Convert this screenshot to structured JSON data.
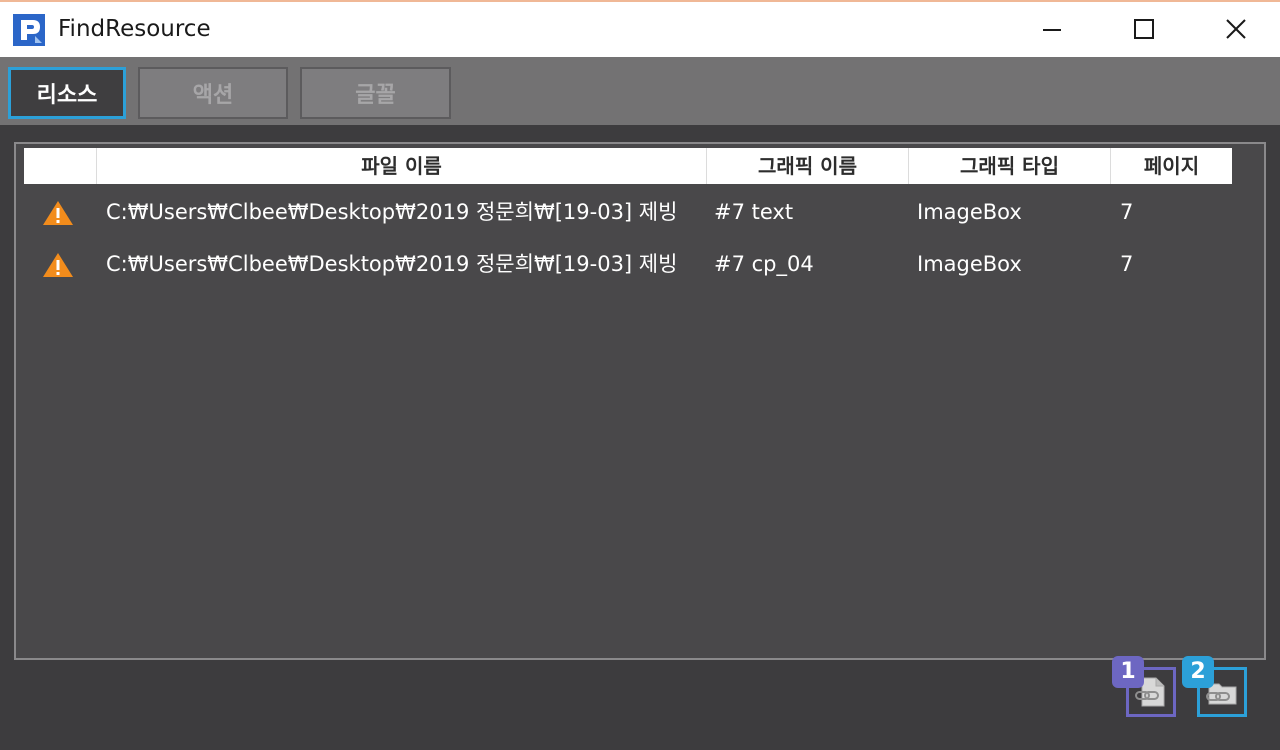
{
  "window": {
    "title": "FindResource",
    "app_icon": "app-logo-icon",
    "controls": [
      "minimize-icon",
      "maximize-icon",
      "close-icon"
    ]
  },
  "tabs": [
    {
      "label": "리소스",
      "active": true
    },
    {
      "label": "액션",
      "active": false
    },
    {
      "label": "글꼴",
      "active": false
    }
  ],
  "table": {
    "columns": [
      "",
      "파일 이름",
      "그래픽 이름",
      "그래픽 타입",
      "페이지"
    ],
    "rows": [
      {
        "status_icon": "warning-icon",
        "file": "C:₩Users₩Clbee₩Desktop₩2019 정문희₩[19-03] 제빙",
        "graphic": "#7 text",
        "type": "ImageBox",
        "page": "7"
      },
      {
        "status_icon": "warning-icon",
        "file": "C:₩Users₩Clbee₩Desktop₩2019 정문희₩[19-03] 제빙",
        "graphic": "#7 cp_04",
        "type": "ImageBox",
        "page": "7"
      }
    ]
  },
  "actions": [
    {
      "badge": "1",
      "icon": "file-link-icon"
    },
    {
      "badge": "2",
      "icon": "folder-link-icon"
    }
  ],
  "colors": {
    "accent_blue": "#2ca0d8",
    "accent_purple": "#6d67c2",
    "warning": "#f28c1c",
    "panel_bg": "#49484a"
  }
}
